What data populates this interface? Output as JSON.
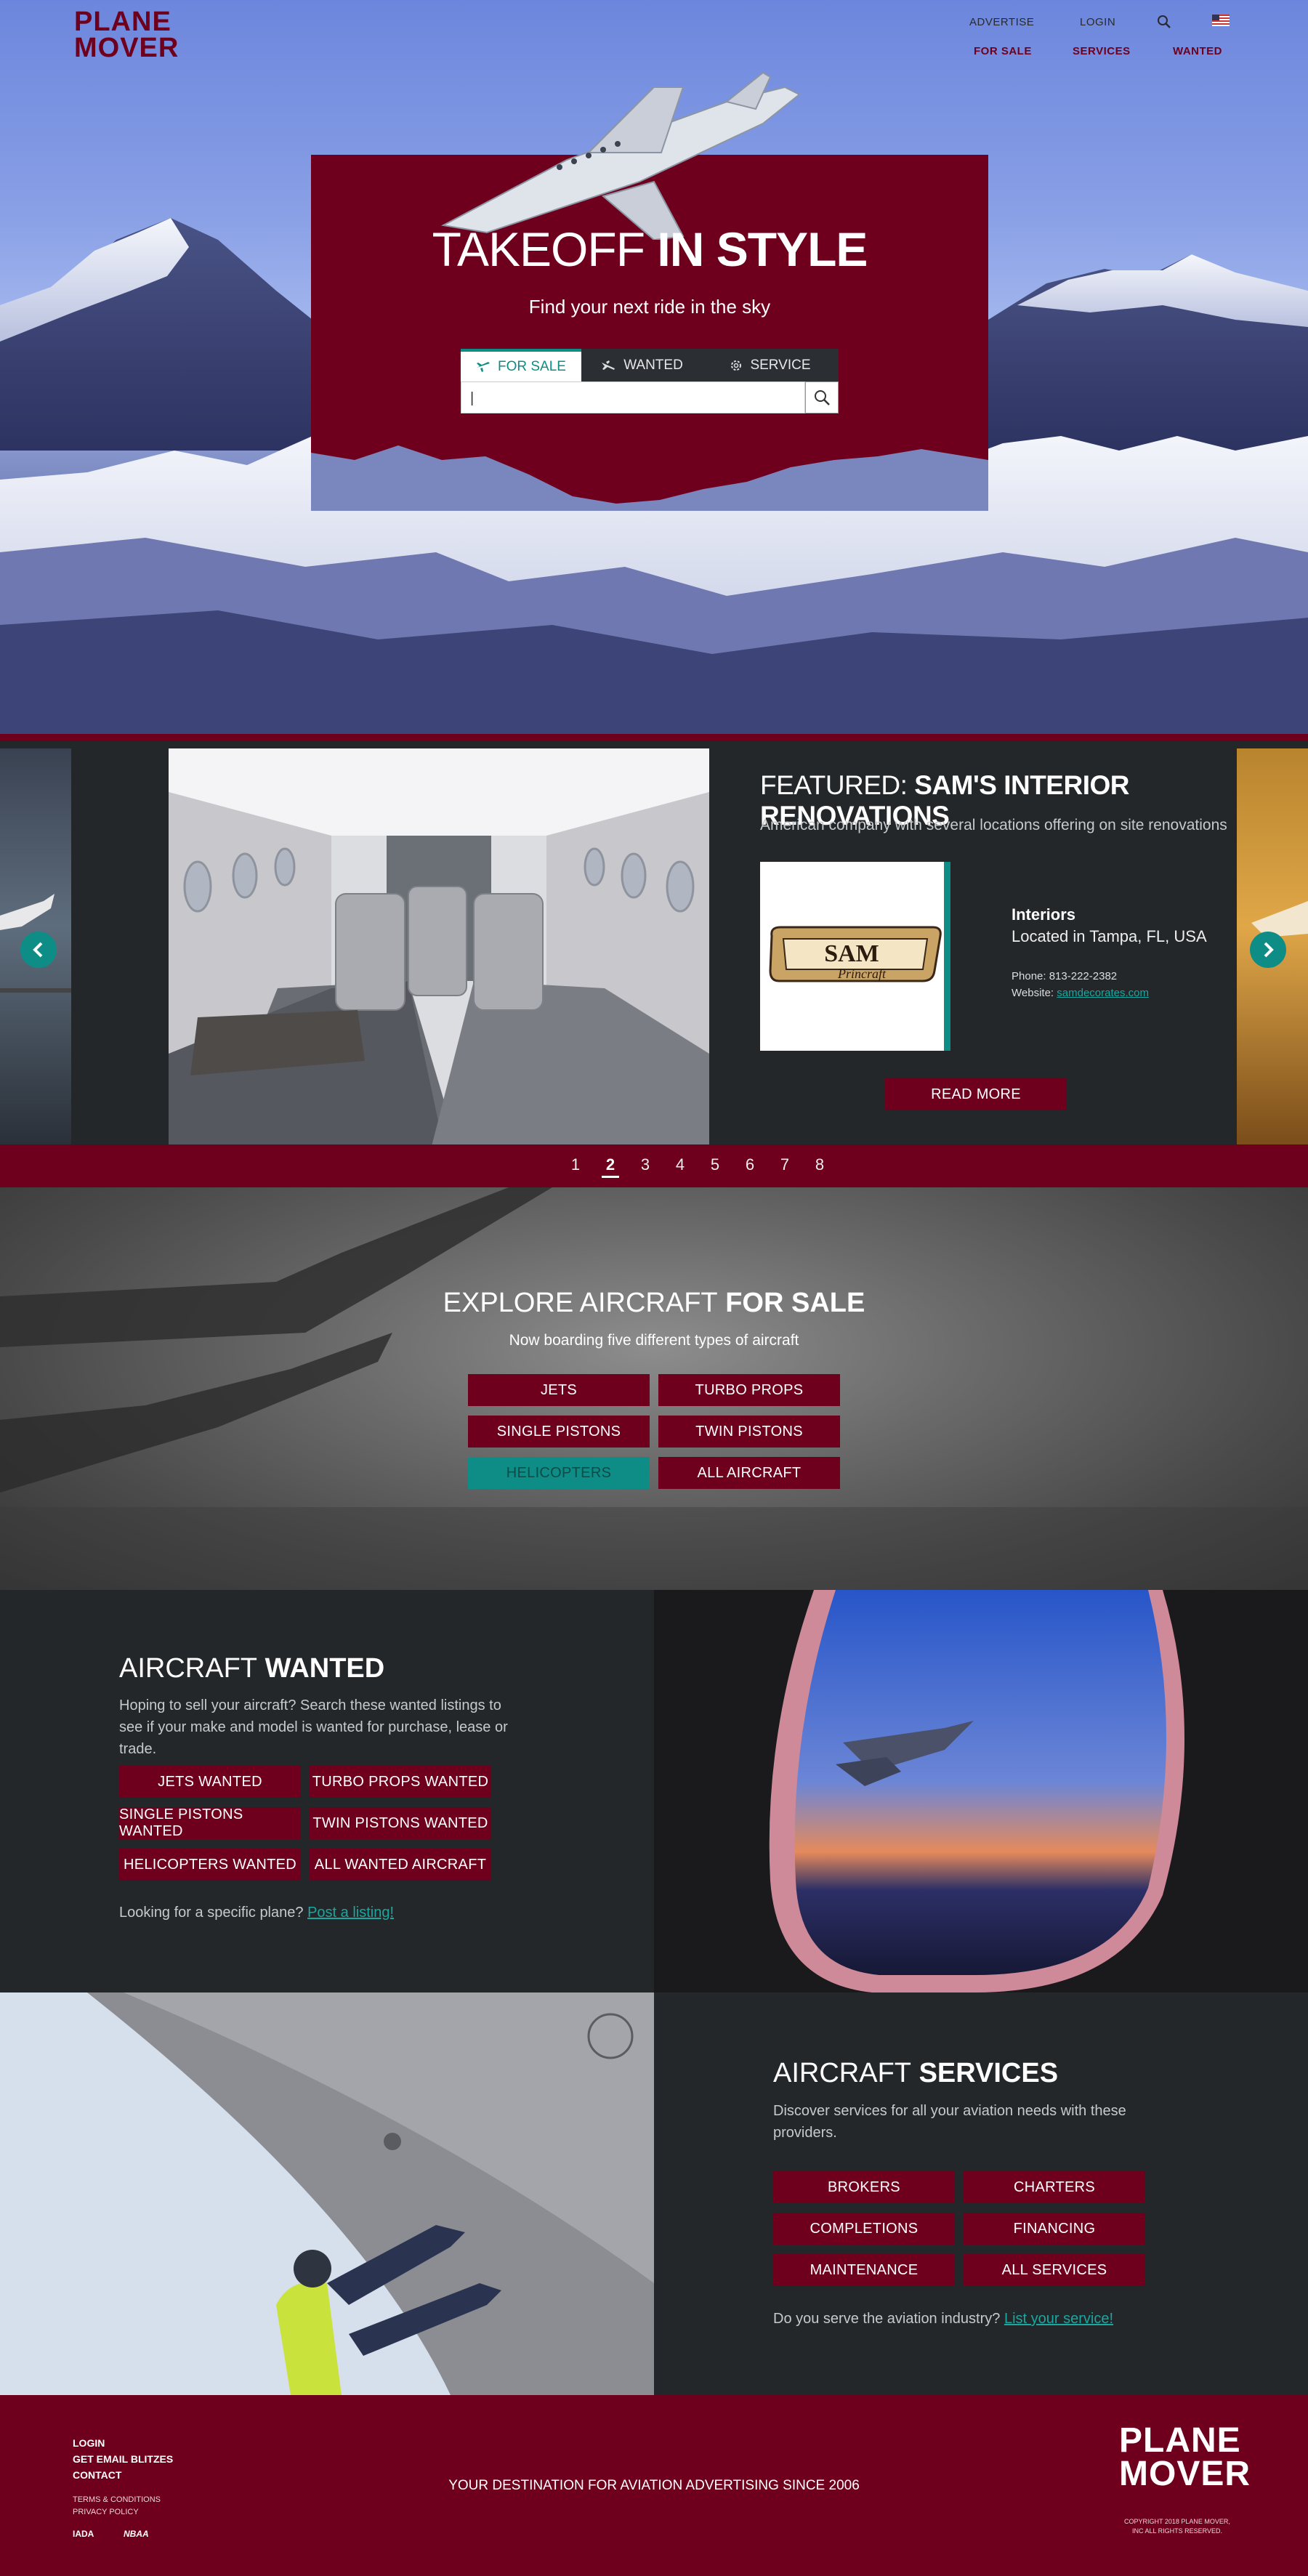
{
  "header": {
    "logo_line1": "PLANE",
    "logo_line2": "MOVER",
    "top_links": [
      "ADVERTISE",
      "LOGIN"
    ],
    "main_links": [
      "FOR SALE",
      "SERVICES",
      "WANTED"
    ],
    "search_icon": "search-icon",
    "flag_icon": "us-flag-icon"
  },
  "hero": {
    "title_light": "TAKEOFF",
    "title_bold": "IN STYLE",
    "subtitle": "Find your next ride in the sky",
    "tabs": [
      {
        "label": "FOR SALE",
        "icon": "plane-icon",
        "active": true
      },
      {
        "label": "WANTED",
        "icon": "plane-down-icon",
        "active": false
      },
      {
        "label": "SERVICE",
        "icon": "gear-icon",
        "active": false
      }
    ],
    "search_value": "|"
  },
  "featured": {
    "title_prefix": "FEATURED:",
    "title_name": "SAM'S INTERIOR RENOVATIONS",
    "description": "American company with several locations offering on site renovations",
    "logo_text_1": "SAM",
    "logo_text_2": "Princraft",
    "category": "Interiors",
    "location": "Located in Tampa, FL, USA",
    "phone": "Phone: 813-222-2382",
    "website_label": "Website:",
    "website": "samdecorates.com",
    "read_more": "READ MORE",
    "pages": [
      "1",
      "2",
      "3",
      "4",
      "5",
      "6",
      "7",
      "8"
    ],
    "current_page": "2"
  },
  "explore": {
    "title_light": "EXPLORE AIRCRAFT",
    "title_bold": "FOR SALE",
    "subtitle": "Now boarding five different types of aircraft",
    "buttons": [
      "JETS",
      "TURBO PROPS",
      "SINGLE PISTONS",
      "TWIN PISTONS",
      "HELICOPTERS",
      "ALL AIRCRAFT"
    ]
  },
  "wanted": {
    "title_light": "AIRCRAFT",
    "title_bold": "WANTED",
    "description": "Hoping to sell your aircraft? Search these wanted listings  to see if your make and model is wanted for purchase, lease or trade.",
    "buttons": [
      "JETS WANTED",
      "TURBO PROPS WANTED",
      "SINGLE PISTONS WANTED",
      "TWIN PISTONS WANTED",
      "HELICOPTERS WANTED",
      "ALL WANTED AIRCRAFT"
    ],
    "footer_text": "Looking for a specific plane?",
    "footer_link": "Post a listing!"
  },
  "services": {
    "title_light": "AIRCRAFT",
    "title_bold": "SERVICES",
    "description": "Discover services for all your aviation needs with these providers.",
    "buttons": [
      "BROKERS",
      "CHARTERS",
      "COMPLETIONS",
      "FINANCING",
      "MAINTENANCE",
      "ALL SERVICES"
    ],
    "footer_text": "Do you serve the aviation industry?",
    "footer_link": "List your service!"
  },
  "footer": {
    "links": [
      "LOGIN",
      "GET EMAIL BLITZES",
      "CONTACT"
    ],
    "legal": [
      "TERMS & CONDITIONS",
      "PRIVACY POLICY"
    ],
    "badges": [
      "IADA",
      "NBAA"
    ],
    "tagline": "YOUR DESTINATION FOR AVIATION ADVERTISING SINCE 2006",
    "logo_line1": "PLANE",
    "logo_line2": "MOVER",
    "copyright_1": "COPYRIGHT 2018 PLANE MOVER,",
    "copyright_2": "INC ALL RIGHTS RESERVED."
  },
  "colors": {
    "brand": "#6f001d",
    "accent": "#0e8d86",
    "panel": "#23272a"
  }
}
